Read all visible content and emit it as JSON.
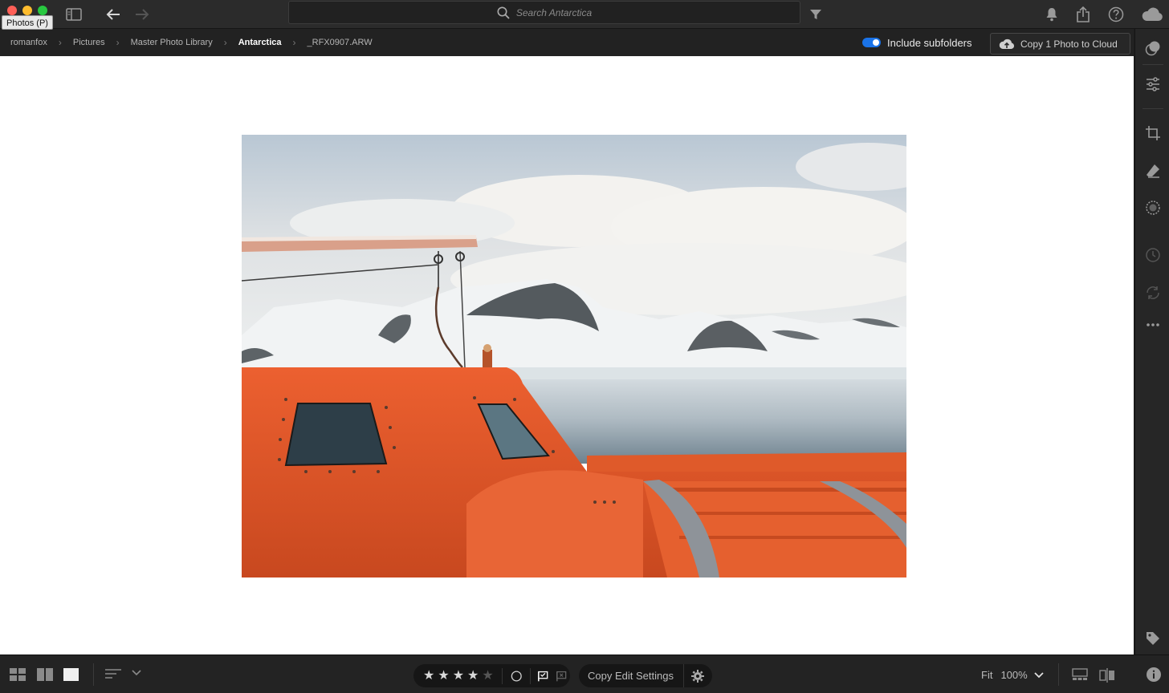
{
  "window": {
    "tooltip": "Photos (P)",
    "traffic_lights": [
      "#ff5f57",
      "#febc2e",
      "#28c840"
    ]
  },
  "toolbar": {
    "search_placeholder": "Search Antarctica"
  },
  "breadcrumb": {
    "items": [
      "romanfox",
      "Pictures",
      "Master Photo Library",
      "Antarctica",
      "_RFX0907.ARW"
    ],
    "active": "Antarctica"
  },
  "subfolders": {
    "label": "Include subfolders",
    "enabled": true
  },
  "cloud_button": {
    "label": "Copy 1 Photo to Cloud"
  },
  "right_panel": {
    "icons": [
      "profile-icon",
      "adjust-sliders-icon",
      "crop-icon",
      "healing-eraser-icon",
      "masking-icon",
      "history-icon",
      "versions-icon",
      "more-icon",
      "tag-icon",
      "info-icon"
    ]
  },
  "rating": {
    "stars": 4,
    "max": 5
  },
  "copy_edit": {
    "label": "Copy Edit Settings"
  },
  "zoom": {
    "fit_label": "Fit",
    "level": "100%"
  },
  "colors": {
    "accent": "#1a73e8",
    "lifeboat_orange": "#e0572a"
  }
}
